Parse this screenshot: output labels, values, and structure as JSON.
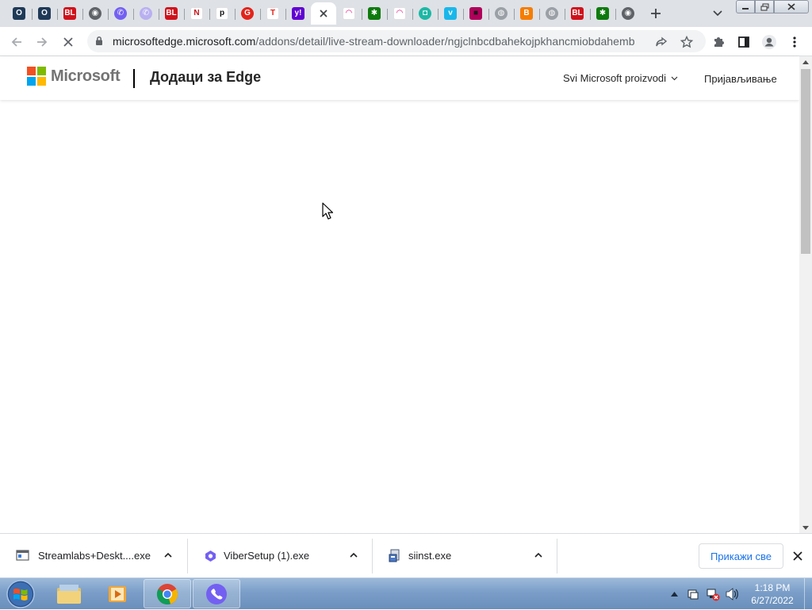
{
  "browser": {
    "tabs": [
      {
        "name": "opera-tab-1",
        "fav": "O",
        "bg": "#1f3a57",
        "fg": "#ffffff",
        "round": false
      },
      {
        "name": "opera-tab-2",
        "fav": "O",
        "bg": "#1f3a57",
        "fg": "#ffffff",
        "round": false
      },
      {
        "name": "blic-tab-1",
        "fav": "BL",
        "bg": "#d0121b",
        "fg": "#ffffff",
        "round": false
      },
      {
        "name": "chrome-tab-1",
        "fav": "◉",
        "bg": "#5f6368",
        "fg": "#ffffff",
        "round": true
      },
      {
        "name": "viber-tab-1",
        "fav": "✆",
        "bg": "#7360f2",
        "fg": "#ffffff",
        "round": true
      },
      {
        "name": "viber-tab-2",
        "fav": "✆",
        "bg": "#b8b0f0",
        "fg": "#ffffff",
        "round": true
      },
      {
        "name": "blic-tab-2",
        "fav": "BL",
        "bg": "#d0121b",
        "fg": "#ffffff",
        "round": false
      },
      {
        "name": "n-tab",
        "fav": "N",
        "bg": "#ffffff",
        "fg": "#c4161c",
        "round": false
      },
      {
        "name": "p-tab",
        "fav": "p",
        "bg": "#ffffff",
        "fg": "#111111",
        "round": false
      },
      {
        "name": "g-tab",
        "fav": "G",
        "bg": "#e2231a",
        "fg": "#ffffff",
        "round": true
      },
      {
        "name": "t-tab",
        "fav": "T",
        "bg": "#ffffff",
        "fg": "#e2231a",
        "round": false
      },
      {
        "name": "yahoo-tab",
        "fav": "y!",
        "bg": "#6001d2",
        "fg": "#ffffff",
        "round": false
      },
      {
        "name": "active-tab",
        "fav": "",
        "bg": "",
        "fg": "",
        "round": false,
        "active": true
      },
      {
        "name": "rainbow-tab-1",
        "fav": "◠",
        "bg": "#ffffff",
        "fg": "#e6007e",
        "round": false
      },
      {
        "name": "gear-tab-1",
        "fav": "✱",
        "bg": "#0e7a0d",
        "fg": "#ffffff",
        "round": false
      },
      {
        "name": "rainbow-tab-2",
        "fav": "◠",
        "bg": "#ffffff",
        "fg": "#e6007e",
        "round": false
      },
      {
        "name": "teal-tab",
        "fav": "◘",
        "bg": "#1db8a5",
        "fg": "#ffffff",
        "round": true
      },
      {
        "name": "vimeo-tab",
        "fav": "v",
        "bg": "#1ab7ea",
        "fg": "#ffffff",
        "round": false
      },
      {
        "name": "magenta-tab",
        "fav": "■",
        "bg": "#b0005a",
        "fg": "#1a1a1a",
        "round": false
      },
      {
        "name": "globe-tab-1",
        "fav": "◍",
        "bg": "#9aa0a6",
        "fg": "#ffffff",
        "round": true
      },
      {
        "name": "blogger-tab",
        "fav": "B",
        "bg": "#f57d00",
        "fg": "#ffffff",
        "round": false
      },
      {
        "name": "globe-tab-2",
        "fav": "◍",
        "bg": "#9aa0a6",
        "fg": "#ffffff",
        "round": true
      },
      {
        "name": "blic-tab-3",
        "fav": "BL",
        "bg": "#d0121b",
        "fg": "#ffffff",
        "round": false
      },
      {
        "name": "gear-tab-2",
        "fav": "✱",
        "bg": "#0e7a0d",
        "fg": "#ffffff",
        "round": false
      },
      {
        "name": "chrome-tab-2",
        "fav": "◉",
        "bg": "#5f6368",
        "fg": "#ffffff",
        "round": true
      }
    ],
    "url_host": "microsoftedge.microsoft.com",
    "url_path": "/addons/detail/live-stream-downloader/ngjclnbcdbahekojpkhancmiobdahemb"
  },
  "site": {
    "brand": "Microsoft",
    "title": "Додаци за Edge",
    "all_products": "Svi Microsoft proizvodi",
    "signin": "Пријављивање",
    "logo_colors": [
      "#f25022",
      "#7fba00",
      "#00a4ef",
      "#ffb900"
    ]
  },
  "downloads": {
    "items": [
      {
        "name": "Streamlabs+Deskt....exe",
        "icon": "installer-window-icon"
      },
      {
        "name": "ViberSetup (1).exe",
        "icon": "viber-setup-icon"
      },
      {
        "name": "siinst.exe",
        "icon": "setup-icon"
      }
    ],
    "show_all": "Прикажи све"
  },
  "taskbar": {
    "time": "1:18 PM",
    "date": "6/27/2022"
  }
}
